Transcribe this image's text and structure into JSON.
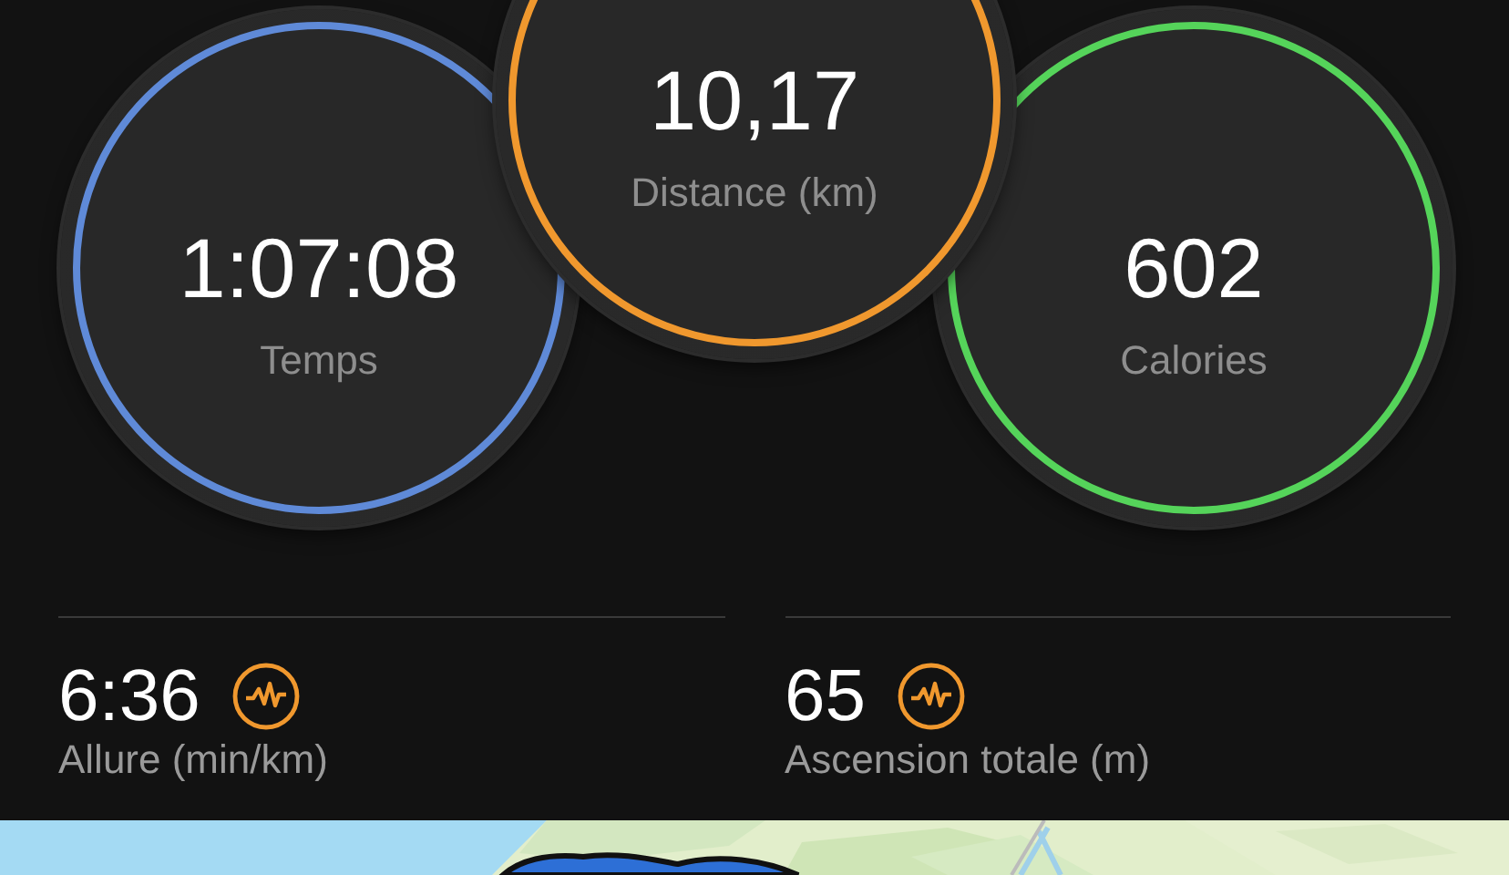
{
  "rings": [
    {
      "value": "1:07:08",
      "label": "Temps",
      "color": "#5f8ad8"
    },
    {
      "value": "10,17",
      "label": "Distance (km)",
      "color": "#f0982e"
    },
    {
      "value": "602",
      "label": "Calories",
      "color": "#55d45a"
    }
  ],
  "metrics": [
    {
      "value": "6:36",
      "label": "Allure (min/km)"
    },
    {
      "value": "65",
      "label": "Ascension totale (m)"
    }
  ]
}
